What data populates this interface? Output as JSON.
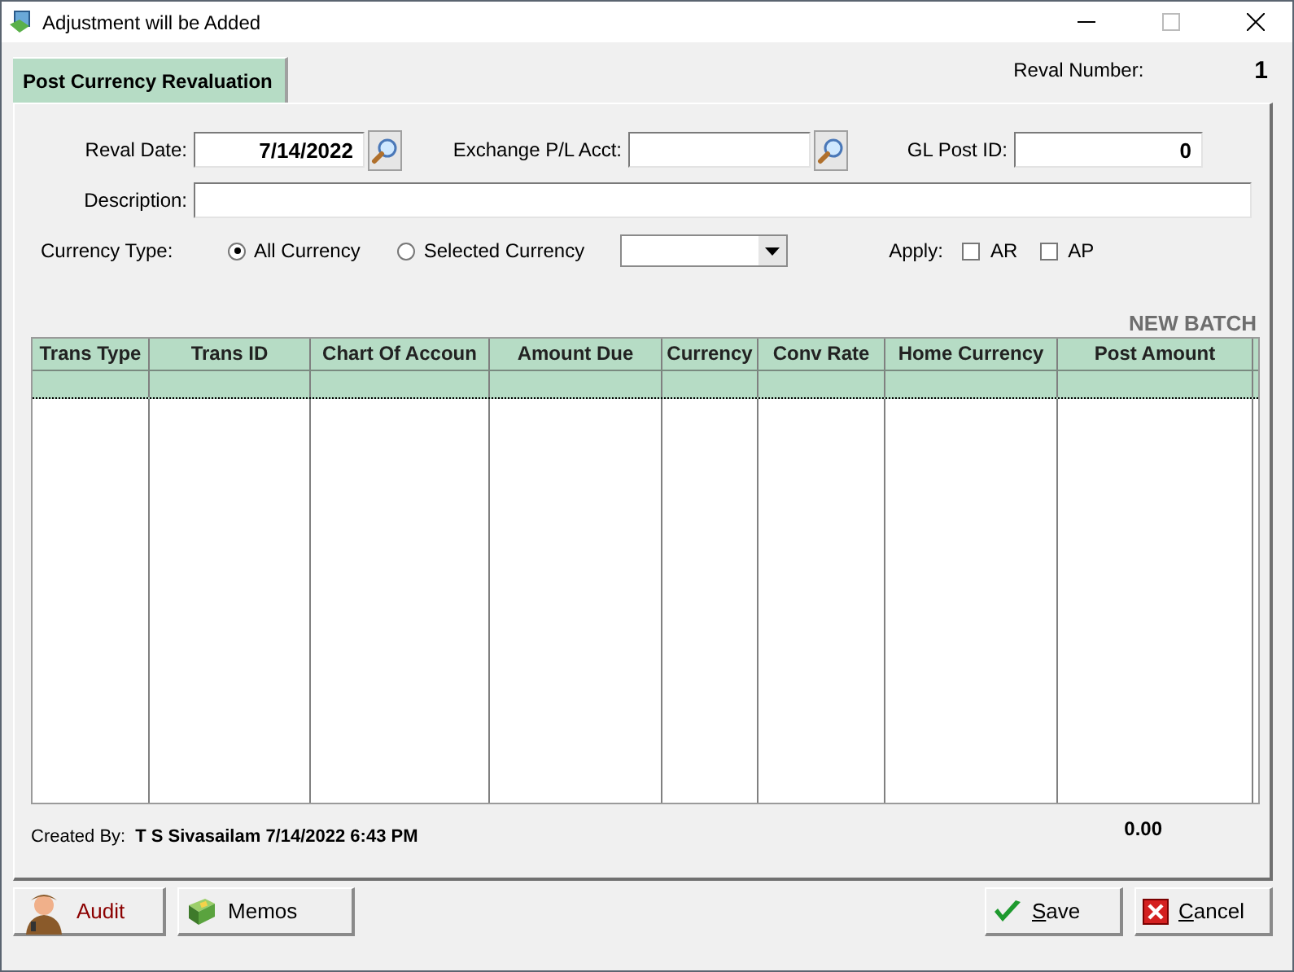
{
  "window": {
    "title": "Adjustment will be Added"
  },
  "tabs": [
    {
      "label": "Post Currency Revaluation",
      "selected": true
    }
  ],
  "reval_number": {
    "label": "Reval Number:",
    "value": "1"
  },
  "form": {
    "reval_date": {
      "label": "Reval Date:",
      "value": "7/14/2022"
    },
    "exchange_acct": {
      "label": "Exchange P/L Acct:"
    },
    "gl_post_id": {
      "label": "GL Post ID:",
      "value": "0"
    },
    "description": {
      "label": "Description:"
    },
    "currency_type": {
      "label": "Currency Type:",
      "options": [
        {
          "label": "All Currency",
          "selected": true
        },
        {
          "label": "Selected Currency",
          "selected": false
        }
      ]
    },
    "apply": {
      "label": "Apply:",
      "options": [
        {
          "label": "AR",
          "checked": false
        },
        {
          "label": "AP",
          "checked": false
        }
      ]
    }
  },
  "batch_label": "NEW BATCH",
  "table": {
    "columns": [
      "Trans Type",
      "Trans ID",
      "Chart Of Accoun",
      "Amount Due",
      "Currency",
      "Conv Rate",
      "Home Currency",
      "Post Amount"
    ],
    "rows": [
      {
        "selected": true
      }
    ]
  },
  "created_by": {
    "label": "Created By:",
    "value": "T S Sivasailam 7/14/2022 6:43 PM"
  },
  "total": "0.00",
  "buttons": [
    {
      "kind": "audit",
      "label": "Audit"
    },
    {
      "kind": "memos",
      "label": "Memos"
    },
    {
      "kind": "save",
      "label": "Save"
    },
    {
      "kind": "cancel",
      "label": "Cancel"
    }
  ]
}
